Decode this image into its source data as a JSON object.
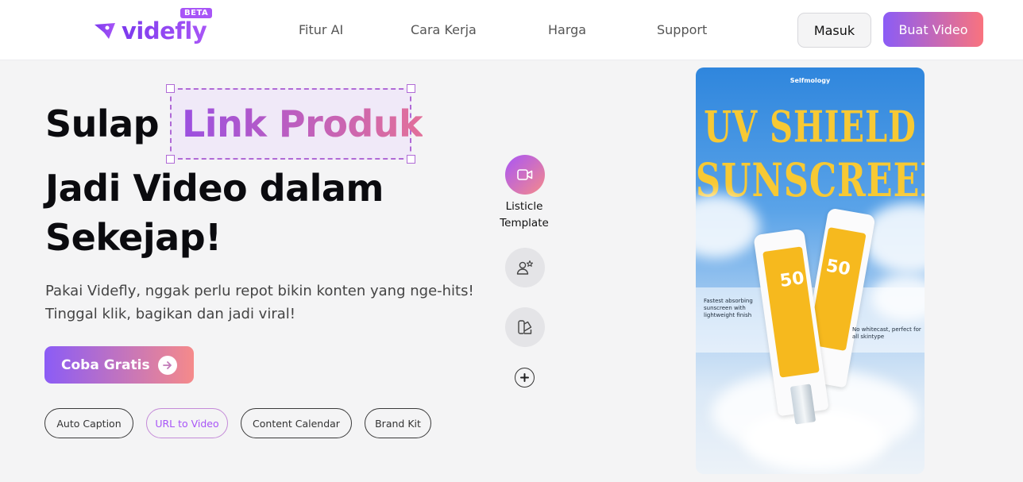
{
  "header": {
    "logo_text": "videfly",
    "beta_badge": "BETA",
    "nav": [
      "Fitur AI",
      "Cara Kerja",
      "Harga",
      "Support"
    ],
    "login_label": "Masuk",
    "cta_label": "Buat Video"
  },
  "hero": {
    "title_prefix": "Sulap",
    "title_highlight": "Link Produk",
    "title_line2": "Jadi Video dalam",
    "title_line3": "Sekejap!",
    "subtitle_line1": "Pakai Videfly, nggak perlu repot bikin konten yang nge-hits!",
    "subtitle_line2": "Tinggal klik, bagikan dan jadi viral!",
    "cta_label": "Coba Gratis",
    "chips": [
      {
        "label": "Auto Caption",
        "active": false
      },
      {
        "label": "URL to Video",
        "active": true
      },
      {
        "label": "Content Calendar",
        "active": false
      },
      {
        "label": "Brand Kit",
        "active": false
      }
    ]
  },
  "templates": {
    "active_label_line1": "Listicle",
    "active_label_line2": "Template",
    "icons": [
      "video-camera-icon",
      "user-star-icon",
      "layers-edit-icon",
      "add-icon"
    ]
  },
  "preview": {
    "brand": "Selfmology",
    "title_line1": "UV SHIELD",
    "title_line2": "SUNSCREEN",
    "spf_value": "50",
    "caption_left_1": "Fastest absorbing",
    "caption_left_2": "sunscreen with",
    "caption_left_3": "lightweight finish",
    "caption_right_1": "No whitecast, perfect for",
    "caption_right_2": "all skintype"
  },
  "colors": {
    "brand_purple": "#8b5cf6",
    "brand_pink": "#f58a8a",
    "page_bg": "#f4f4f5"
  }
}
